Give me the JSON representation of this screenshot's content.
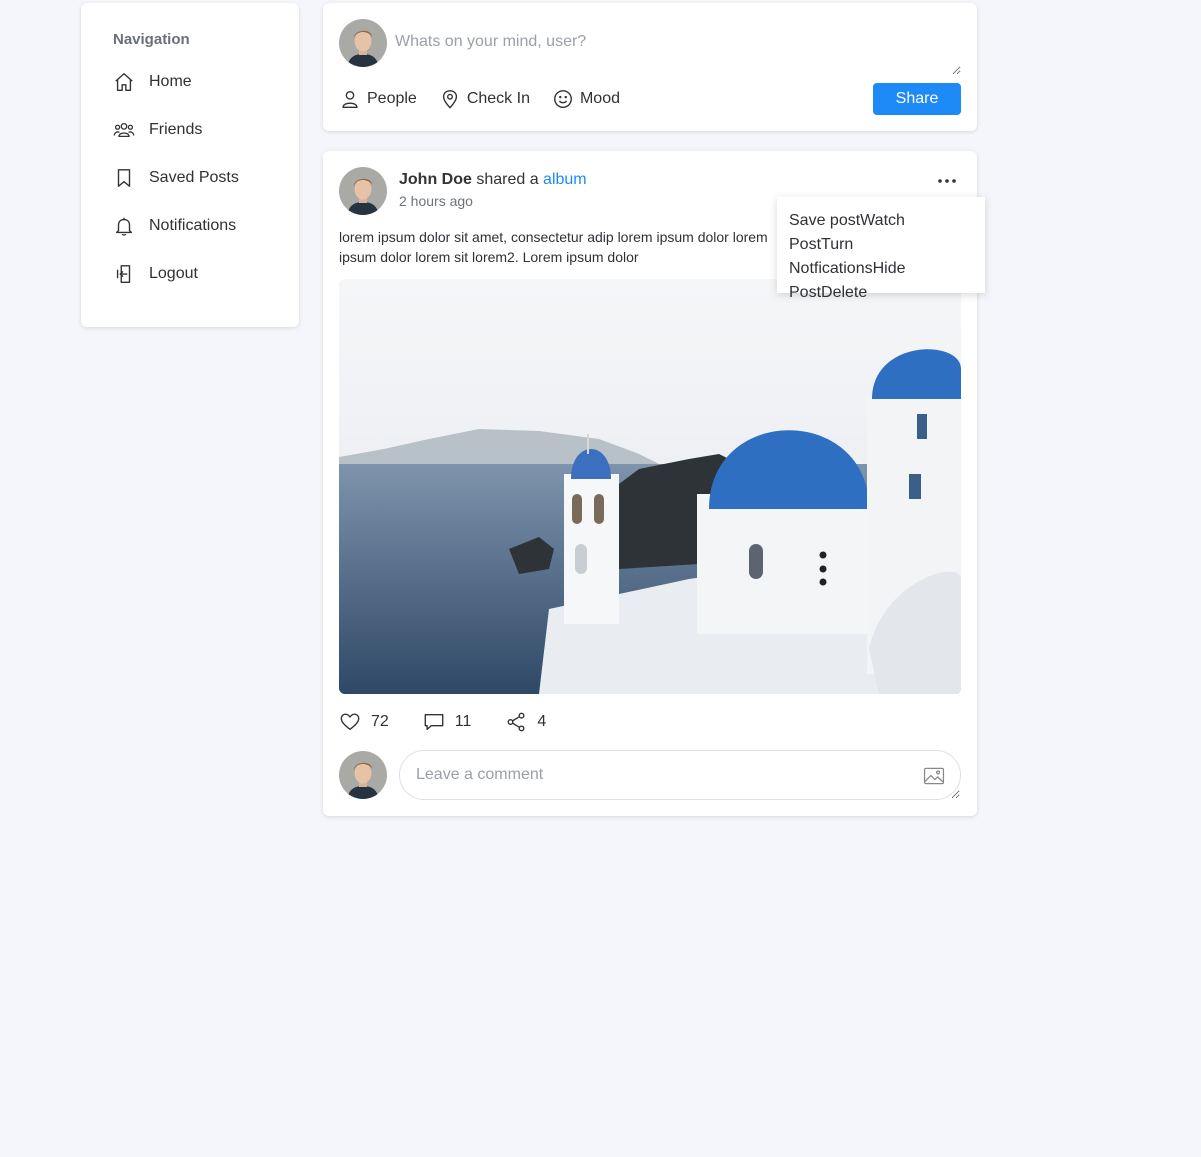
{
  "navigation": {
    "title": "Navigation",
    "items": [
      {
        "label": "Home",
        "icon": "home-icon"
      },
      {
        "label": "Friends",
        "icon": "friends-icon"
      },
      {
        "label": "Saved Posts",
        "icon": "bookmark-icon"
      },
      {
        "label": "Notifications",
        "icon": "bell-icon"
      },
      {
        "label": "Logout",
        "icon": "logout-icon"
      }
    ]
  },
  "composer": {
    "placeholder": "Whats on your mind, user?",
    "actions": [
      {
        "label": "People",
        "icon": "person-icon"
      },
      {
        "label": "Check In",
        "icon": "location-pin-icon"
      },
      {
        "label": "Mood",
        "icon": "smiley-icon"
      }
    ],
    "share_label": "Share"
  },
  "post": {
    "author": "John Doe",
    "action_text": " shared a ",
    "link_text": "album",
    "time": "2 hours ago",
    "text": "lorem ipsum dolor sit amet, consectetur adip lorem ipsum dolor lorem ipsum dolor lorem sit lorem2. Lorem ipsum dolor",
    "stats": {
      "likes": "72",
      "comments": "11",
      "shares": "4"
    },
    "comment_placeholder": "Leave a comment",
    "menu": {
      "items": [
        "Save post",
        "Watch Post",
        "Turn Notfications",
        "Hide Post",
        "Delete"
      ]
    }
  },
  "colors": {
    "accent": "#1e8af7",
    "background": "#f4f6fb"
  }
}
